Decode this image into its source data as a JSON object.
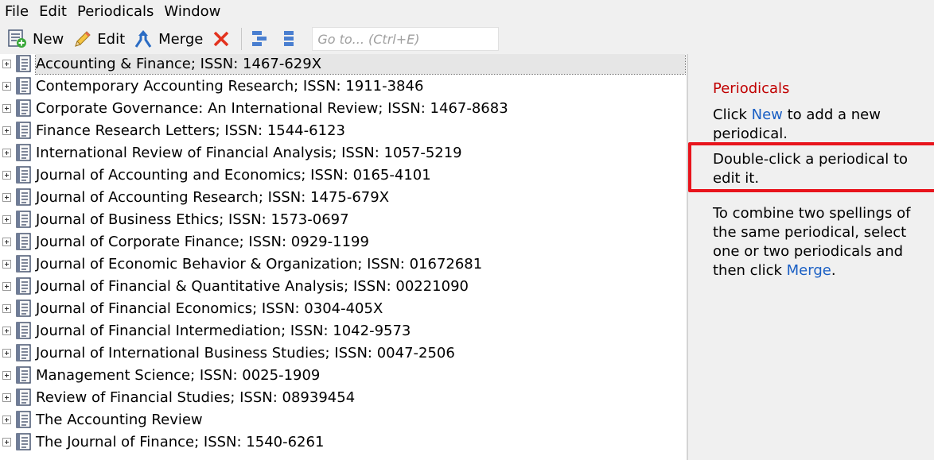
{
  "menu": [
    "File",
    "Edit",
    "Periodicals",
    "Window"
  ],
  "toolbar": {
    "new_label": "New",
    "edit_label": "Edit",
    "merge_label": "Merge",
    "goto_placeholder": "Go to... (Ctrl+E)"
  },
  "periodicals": [
    "Accounting & Finance; ISSN: 1467-629X",
    "Contemporary Accounting Research; ISSN: 1911-3846",
    "Corporate Governance: An International Review; ISSN: 1467-8683",
    "Finance Research Letters; ISSN: 1544-6123",
    "International Review of Financial Analysis; ISSN: 1057-5219",
    "Journal of Accounting and Economics; ISSN: 0165-4101",
    "Journal of Accounting Research; ISSN: 1475-679X",
    "Journal of Business Ethics; ISSN: 1573-0697",
    "Journal of Corporate Finance; ISSN: 0929-1199",
    "Journal of Economic Behavior & Organization; ISSN: 01672681",
    "Journal of Financial & Quantitative Analysis; ISSN: 00221090",
    "Journal of Financial Economics; ISSN: 0304-405X",
    "Journal of Financial Intermediation; ISSN: 1042-9573",
    "Journal of International Business Studies; ISSN: 0047-2506",
    "Management Science; ISSN: 0025-1909",
    "Review of Financial Studies; ISSN: 08939454",
    "The Accounting Review",
    "The Journal of Finance; ISSN: 1540-6261"
  ],
  "selected_index": 0,
  "help": {
    "title": "Periodicals",
    "p1_before": "Click ",
    "p1_link": "New",
    "p1_after": " to add a new periodical.",
    "p2": "Double-click a periodical to edit it.",
    "p3_before": "To combine two spellings of the same periodical, select one or two periodicals and then click ",
    "p3_link": "Merge",
    "p3_after": "."
  },
  "colors": {
    "help_title": "#c00000",
    "link": "#1a5fc4",
    "highlight_box": "#e8141c"
  },
  "icons": {
    "new": "new-periodical-icon",
    "edit": "pencil-icon",
    "merge": "merge-icon",
    "delete": "delete-x-icon",
    "expand_all": "expand-all-icon",
    "collapse_all": "collapse-all-icon",
    "row": "periodical-document-icon",
    "expander": "expand-plus-icon"
  }
}
